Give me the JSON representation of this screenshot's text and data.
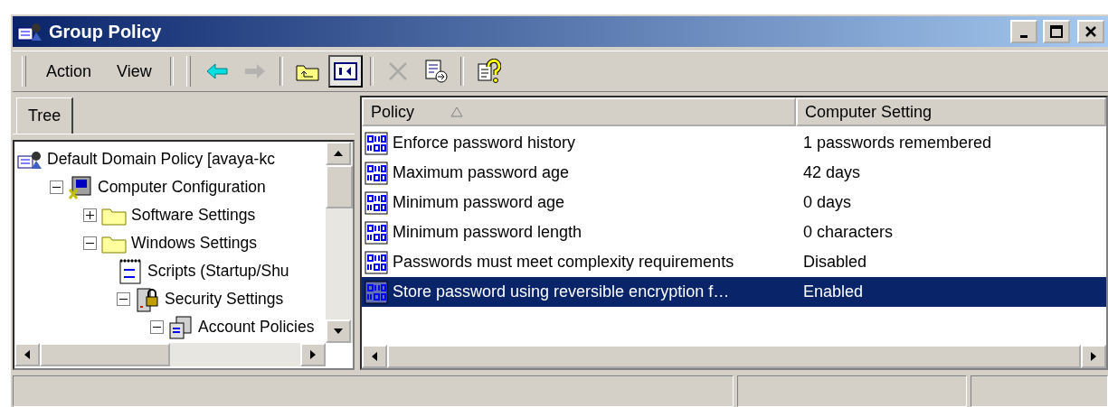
{
  "window": {
    "title": "Group Policy"
  },
  "menu": [
    {
      "label": "Action"
    },
    {
      "label": "View"
    }
  ],
  "toolbar": [
    {
      "kind": "back",
      "disabled": false,
      "selected": false
    },
    {
      "kind": "forward",
      "disabled": true,
      "selected": false
    },
    {
      "kind": "up",
      "disabled": false,
      "selected": false
    },
    {
      "kind": "pane",
      "disabled": false,
      "selected": true
    },
    {
      "kind": "delete",
      "disabled": true,
      "selected": false
    },
    {
      "kind": "export",
      "disabled": false,
      "selected": false
    },
    {
      "kind": "help",
      "disabled": false,
      "selected": false
    }
  ],
  "tabs": [
    {
      "label": "Tree",
      "selected": true
    }
  ],
  "tree": [
    {
      "label": "Default Domain Policy [avaya-kc",
      "kind": "policy",
      "children": [
        {
          "label": "Computer Configuration",
          "kind": "computer",
          "expanded": true,
          "children": [
            {
              "label": "Software Settings",
              "kind": "folder",
              "expanded": false
            },
            {
              "label": "Windows Settings",
              "kind": "folder",
              "expanded": true,
              "children": [
                {
                  "label": "Scripts (Startup/Shu",
                  "kind": "script"
                },
                {
                  "label": "Security Settings",
                  "kind": "security",
                  "expanded": true,
                  "children": [
                    {
                      "label": "Account Policies",
                      "kind": "account",
                      "expanded": true
                    }
                  ]
                }
              ]
            }
          ]
        }
      ]
    }
  ],
  "table": {
    "columns": [
      {
        "label": "Policy",
        "sorted": true
      },
      {
        "label": "Computer Setting",
        "sorted": false
      }
    ],
    "rows": [
      {
        "policy": "Enforce password history",
        "setting": "1 passwords remembered",
        "selected": false
      },
      {
        "policy": "Maximum password age",
        "setting": "42 days",
        "selected": false
      },
      {
        "policy": "Minimum password age",
        "setting": "0 days",
        "selected": false
      },
      {
        "policy": "Minimum password length",
        "setting": "0 characters",
        "selected": false
      },
      {
        "policy": "Passwords must meet complexity requirements",
        "setting": "Disabled",
        "selected": false
      },
      {
        "policy": "Store password using reversible encryption f…",
        "setting": "Enabled",
        "selected": true
      }
    ]
  }
}
